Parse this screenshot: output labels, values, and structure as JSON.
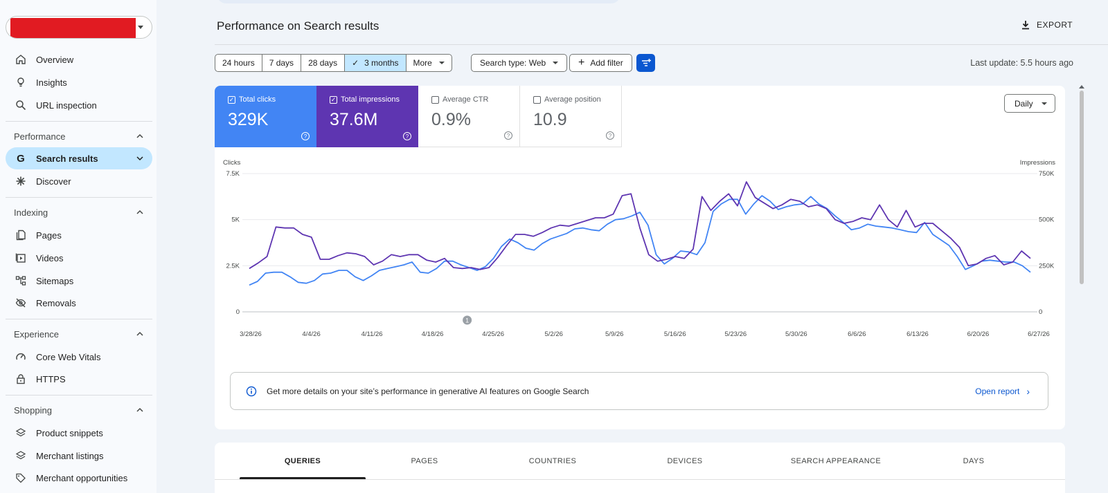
{
  "sidebar": {
    "overview": "Overview",
    "insights": "Insights",
    "url_inspection": "URL inspection",
    "performance": "Performance",
    "search_results": "Search results",
    "discover": "Discover",
    "indexing": "Indexing",
    "pages": "Pages",
    "videos": "Videos",
    "sitemaps": "Sitemaps",
    "removals": "Removals",
    "experience": "Experience",
    "core_web_vitals": "Core Web Vitals",
    "https": "HTTPS",
    "shopping": "Shopping",
    "product_snippets": "Product snippets",
    "merchant_listings": "Merchant listings",
    "merchant_opportunities": "Merchant opportunities"
  },
  "header": {
    "title": "Performance on Search results",
    "export": "EXPORT",
    "last_update": "Last update: 5.5 hours ago"
  },
  "filters": {
    "date_ranges": [
      "24 hours",
      "7 days",
      "28 days",
      "3 months",
      "More"
    ],
    "selected_range": "3 months",
    "search_type": "Search type: Web",
    "add_filter": "Add filter"
  },
  "metrics": {
    "clicks": {
      "label": "Total clicks",
      "value": "329K",
      "checked": true
    },
    "impressions": {
      "label": "Total impressions",
      "value": "37.6M",
      "checked": true
    },
    "ctr": {
      "label": "Average CTR",
      "value": "0.9%",
      "checked": false
    },
    "position": {
      "label": "Average position",
      "value": "10.9",
      "checked": false
    }
  },
  "granularity": "Daily",
  "chart_data": {
    "type": "line",
    "left_axis_label": "Clicks",
    "right_axis_label": "Impressions",
    "left_ticks": [
      "0",
      "2.5K",
      "5K",
      "7.5K"
    ],
    "right_ticks": [
      "0",
      "250K",
      "500K",
      "750K"
    ],
    "ylim_left": [
      0,
      7500
    ],
    "ylim_right": [
      0,
      750000
    ],
    "x_labels": [
      "3/28/26",
      "4/4/26",
      "4/11/26",
      "4/18/26",
      "4/25/26",
      "5/2/26",
      "5/9/26",
      "5/16/26",
      "5/23/26",
      "5/30/26",
      "6/6/26",
      "6/13/26",
      "6/20/26",
      "6/27/26"
    ],
    "annotation": {
      "label": "1",
      "date": "4/22/26"
    },
    "colors": {
      "clicks": "#4285f4",
      "impressions": "#5e35b1"
    },
    "series": [
      {
        "name": "Clicks",
        "axis": "left",
        "values": [
          1450,
          1650,
          2100,
          2150,
          2150,
          1900,
          1600,
          1550,
          1700,
          2050,
          2100,
          2250,
          2250,
          1900,
          1700,
          1950,
          2250,
          2350,
          2450,
          2550,
          2700,
          2150,
          2100,
          2350,
          2750,
          2750,
          2550,
          2400,
          2250,
          2450,
          2900,
          3550,
          3950,
          3750,
          3450,
          3350,
          3700,
          3950,
          4100,
          4250,
          4500,
          4550,
          4450,
          4400,
          4750,
          5000,
          5050,
          5200,
          5400,
          4700,
          3100,
          2600,
          2900,
          3300,
          3250,
          3100,
          3750,
          5450,
          5850,
          6100,
          6100,
          5300,
          5850,
          6300,
          6000,
          5550,
          5700,
          5800,
          5850,
          6250,
          5850,
          5600,
          5200,
          4850,
          4450,
          4550,
          4750,
          4650,
          4600,
          4550,
          4450,
          4350,
          4300,
          4850,
          4200,
          3900,
          3600,
          3000,
          2300,
          2500,
          2750,
          2800,
          2750,
          2700,
          2700,
          2500,
          2150
        ]
      },
      {
        "name": "Impressions",
        "axis": "right",
        "values": [
          235000,
          265000,
          300000,
          460000,
          455000,
          455000,
          420000,
          405000,
          285000,
          285000,
          305000,
          320000,
          315000,
          300000,
          255000,
          275000,
          310000,
          300000,
          310000,
          310000,
          280000,
          270000,
          290000,
          240000,
          235000,
          240000,
          230000,
          240000,
          295000,
          360000,
          420000,
          420000,
          410000,
          430000,
          455000,
          470000,
          465000,
          480000,
          495000,
          510000,
          510000,
          530000,
          630000,
          640000,
          455000,
          310000,
          275000,
          285000,
          300000,
          290000,
          340000,
          625000,
          550000,
          600000,
          640000,
          575000,
          705000,
          620000,
          590000,
          560000,
          580000,
          610000,
          600000,
          570000,
          580000,
          560000,
          500000,
          480000,
          490000,
          510000,
          500000,
          580000,
          500000,
          460000,
          550000,
          460000,
          480000,
          480000,
          440000,
          400000,
          350000,
          250000,
          260000,
          290000,
          305000,
          255000,
          270000,
          330000,
          290000
        ]
      }
    ]
  },
  "ai_banner": {
    "text": "Get more details on your site’s performance in generative AI features on Google Search",
    "link": "Open report"
  },
  "tabs": [
    "QUERIES",
    "PAGES",
    "COUNTRIES",
    "DEVICES",
    "SEARCH APPEARANCE",
    "DAYS"
  ],
  "active_tab": "QUERIES"
}
